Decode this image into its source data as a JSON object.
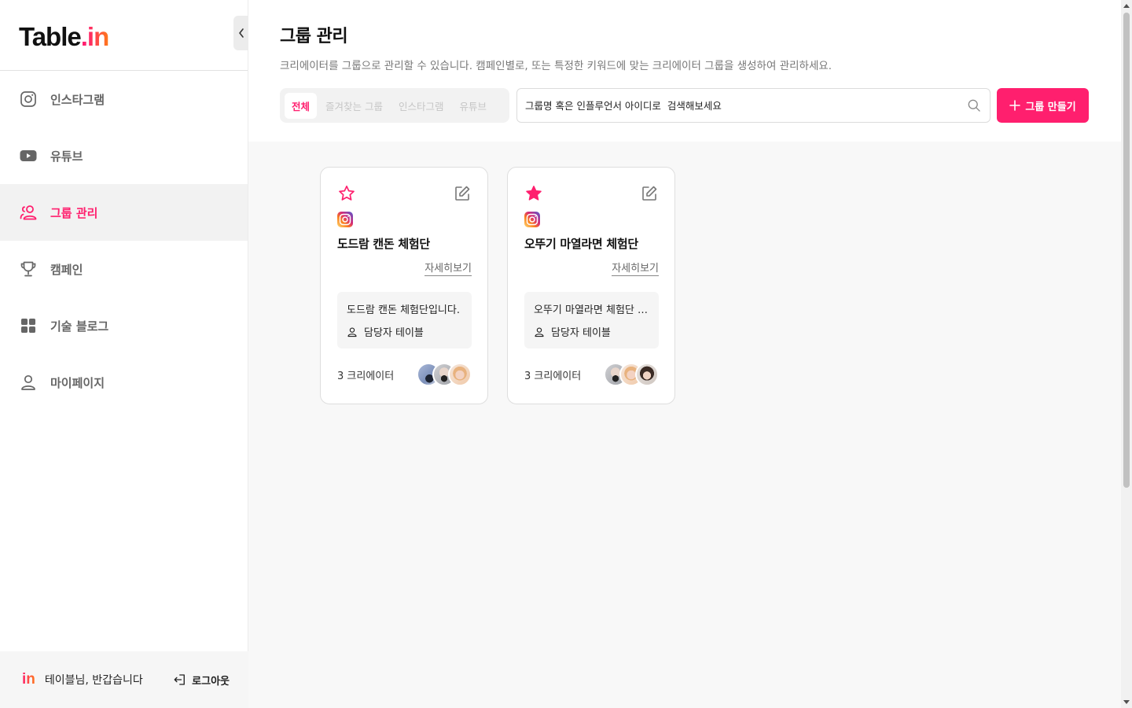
{
  "app": {
    "logo_main": "Table",
    "logo_dot": ".",
    "logo_accent": "in",
    "brand_color": "#ff1f6e"
  },
  "sidebar": {
    "items": [
      {
        "label": "인스타그램",
        "icon": "instagram-icon"
      },
      {
        "label": "유튜브",
        "icon": "youtube-icon"
      },
      {
        "label": "그룹 관리",
        "icon": "group-icon",
        "active": true
      },
      {
        "label": "캠페인",
        "icon": "trophy-icon"
      },
      {
        "label": "기술 블로그",
        "icon": "grid-icon"
      },
      {
        "label": "마이페이지",
        "icon": "user-icon"
      }
    ],
    "footer": {
      "logo": "in",
      "greeting": "테이블님, 반갑습니다",
      "logout_label": "로그아웃"
    }
  },
  "header": {
    "title": "그룹 관리",
    "description": "크리에이터를 그룹으로 관리할 수 있습니다. 캠페인별로, 또는 특정한 키워드에 맞는 크리에이터 그룹을 생성하여 관리하세요."
  },
  "filters": {
    "tabs": [
      {
        "label": "전체",
        "active": true
      },
      {
        "label": "즐겨찾는 그룹"
      },
      {
        "label": "인스타그램"
      },
      {
        "label": "유튜브"
      }
    ]
  },
  "search": {
    "placeholder": "그룹명 혹은 인플루언서 아이디로  검색해보세요"
  },
  "create_button": {
    "label": "그룹 만들기"
  },
  "groups": [
    {
      "title": "도드람 캔돈 체험단",
      "favorite": false,
      "platform": "instagram",
      "detail_label": "자세히보기",
      "description": "도드람 캔돈 체험단입니다.",
      "owner": "담당자 테이블",
      "creator_count": "3 크리에이터"
    },
    {
      "title": "오뚜기 마열라면 체험단",
      "favorite": true,
      "platform": "instagram",
      "detail_label": "자세히보기",
      "description": "오뚜기 마열라면 체험단 인스타그램 캠페인",
      "owner": "담당자 테이블",
      "creator_count": "3 크리에이터"
    }
  ]
}
